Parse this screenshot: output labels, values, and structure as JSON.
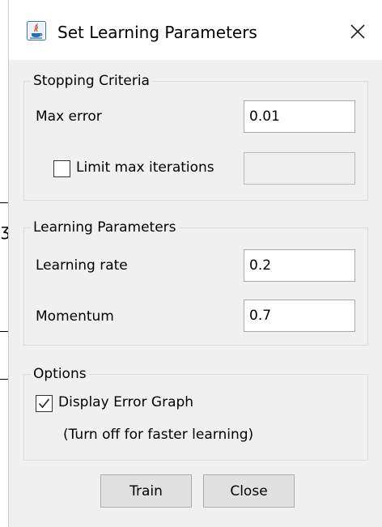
{
  "window": {
    "title": "Set Learning Parameters",
    "icon": "java-app-icon",
    "close_icon": "close-icon"
  },
  "stopping_criteria": {
    "group_label": "Stopping Criteria",
    "max_error_label": "Max error",
    "max_error_value": "0.01",
    "limit_iterations_label": "Limit max iterations",
    "limit_iterations_checked": false,
    "max_iterations_value": ""
  },
  "learning_parameters": {
    "group_label": "Learning Parameters",
    "learning_rate_label": "Learning rate",
    "learning_rate_value": "0.2",
    "momentum_label": "Momentum",
    "momentum_value": "0.7"
  },
  "options": {
    "group_label": "Options",
    "display_error_graph_label": "Display Error Graph",
    "display_error_graph_checked": true,
    "hint": "(Turn off for faster learning)"
  },
  "buttons": {
    "train": "Train",
    "close": "Close"
  },
  "colors": {
    "dialog_background": "#f0f0f0",
    "titlebar_background": "#ffffff",
    "group_border": "#dcdcdc",
    "button_face": "#e1e1e1"
  }
}
